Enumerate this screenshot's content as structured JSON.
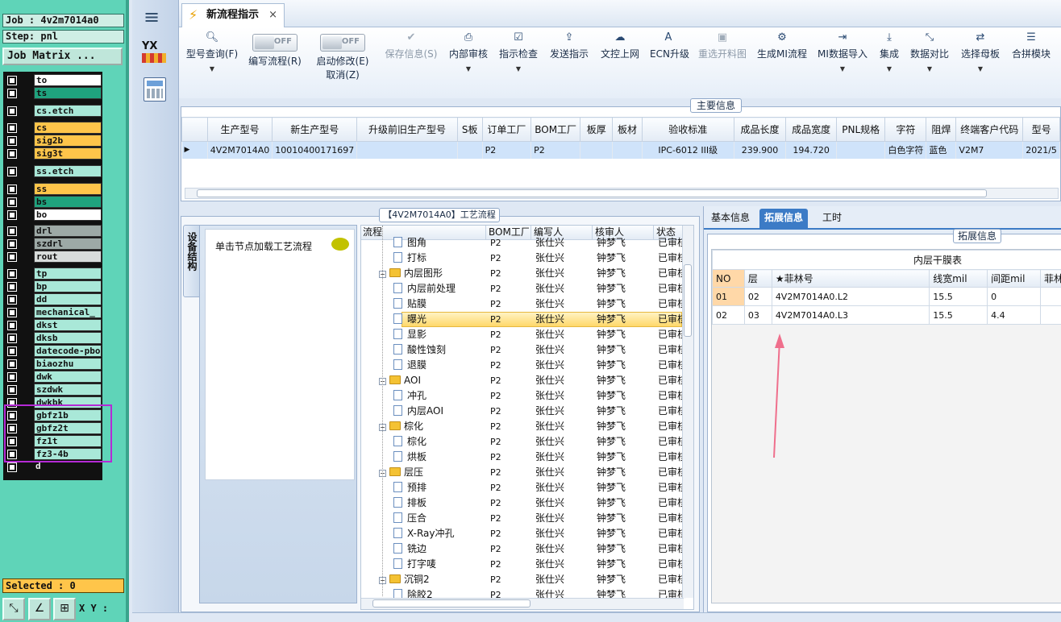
{
  "genesis": {
    "job": "Job : 4v2m7014a0",
    "step": "Step: pnl",
    "matrix_button": "Job Matrix ...",
    "selected": "Selected : 0",
    "xy_label": "X Y :",
    "layers": [
      {
        "name": "to",
        "color": "#ffffff"
      },
      {
        "name": "ts",
        "color": "#1fa37e"
      },
      {
        "name": "cs.etch",
        "color": "#a9e8d8"
      },
      {
        "name": "cs",
        "color": "#ffc54a"
      },
      {
        "name": "sig2b",
        "color": "#ffc54a"
      },
      {
        "name": "sig3t",
        "color": "#ffc54a"
      },
      {
        "name": "ss.etch",
        "color": "#a9e8d8"
      },
      {
        "name": "ss",
        "color": "#ffc54a"
      },
      {
        "name": "bs",
        "color": "#1fa37e"
      },
      {
        "name": "bo",
        "color": "#ffffff"
      },
      {
        "name": "drl",
        "color": "#9da9a6"
      },
      {
        "name": "szdrl",
        "color": "#9da9a6"
      },
      {
        "name": "rout",
        "color": "#d8dcdb"
      },
      {
        "name": "tp",
        "color": "#a9e8d8"
      },
      {
        "name": "bp",
        "color": "#a9e8d8"
      },
      {
        "name": "dd",
        "color": "#a9e8d8"
      },
      {
        "name": "mechanical_",
        "color": "#a9e8d8"
      },
      {
        "name": "dkst",
        "color": "#a9e8d8"
      },
      {
        "name": "dksb",
        "color": "#a9e8d8"
      },
      {
        "name": "datecode-pbo",
        "color": "#a9e8d8"
      },
      {
        "name": "biaozhu",
        "color": "#a9e8d8"
      },
      {
        "name": "dwk",
        "color": "#a9e8d8"
      },
      {
        "name": "szdwk",
        "color": "#a9e8d8"
      },
      {
        "name": "dwkbk",
        "color": "#a9e8d8"
      },
      {
        "name": "gbfz1b",
        "color": "#a9e8d8"
      },
      {
        "name": "gbfz2t",
        "color": "#a9e8d8"
      },
      {
        "name": "fz1t",
        "color": "#a9e8d8"
      },
      {
        "name": "fz3-4b",
        "color": "#a9e8d8"
      },
      {
        "name": "d",
        "color": "#111111"
      }
    ]
  },
  "nav": {
    "logo_text": "YX"
  },
  "tab": {
    "title": "新流程指示",
    "close": "×"
  },
  "toolbar": {
    "query": "型号查询(F)",
    "edit_flow": "编写流程(R)",
    "start_modify": "启动修改(E)",
    "cancel": "取消(Z)",
    "off": "OFF",
    "save": "保存信息(S)",
    "internal_review": "内部审核",
    "check": "指示检查",
    "send": "发送指示",
    "upload": "文控上网",
    "ecn": "ECN升级",
    "reopen": "重选开料图",
    "gen_mi": "生成MI流程",
    "mi_import": "MI数据导入",
    "integrate": "集成",
    "compare": "数据对比",
    "select_master": "选择母板",
    "panelize": "合拼模块"
  },
  "main_info": {
    "title": "主要信息",
    "headers": [
      "生产型号",
      "新生产型号",
      "升级前旧生产型号",
      "S板",
      "订单工厂",
      "BOM工厂",
      "板厚",
      "板材",
      "验收标准",
      "成品长度",
      "成品宽度",
      "PNL规格",
      "字符",
      "阻焊",
      "终端客户代码",
      "型号"
    ],
    "row": [
      "4V2M7014A0",
      "10010400171697",
      "",
      "",
      "P2",
      "P2",
      "",
      "",
      "IPC-6012 III级",
      "239.900",
      "194.720",
      "",
      "白色字符",
      "蓝色",
      "V2M7",
      "2021/5"
    ]
  },
  "process": {
    "title": "【4V2M7014A0】工艺流程",
    "side_tab": "设备结构",
    "hint": "单击节点加载工艺流程",
    "headers": [
      "流程",
      "BOM工厂",
      "编写人",
      "核审人",
      "状态"
    ],
    "rows": [
      {
        "level": 2,
        "type": "doc",
        "name": "图角",
        "bom": "P2",
        "writer": "张仕兴",
        "reviewer": "钟梦飞",
        "status": "已审核"
      },
      {
        "level": 2,
        "type": "doc",
        "name": "打标",
        "bom": "P2",
        "writer": "张仕兴",
        "reviewer": "钟梦飞",
        "status": "已审核"
      },
      {
        "level": 1,
        "type": "folder",
        "name": "内层图形",
        "bom": "P2",
        "writer": "张仕兴",
        "reviewer": "钟梦飞",
        "status": "已审核"
      },
      {
        "level": 2,
        "type": "doc",
        "name": "内层前处理",
        "bom": "P2",
        "writer": "张仕兴",
        "reviewer": "钟梦飞",
        "status": "已审核"
      },
      {
        "level": 2,
        "type": "doc",
        "name": "贴膜",
        "bom": "P2",
        "writer": "张仕兴",
        "reviewer": "钟梦飞",
        "status": "已审核"
      },
      {
        "level": 2,
        "type": "doc",
        "name": "曝光",
        "bom": "P2",
        "writer": "张仕兴",
        "reviewer": "钟梦飞",
        "status": "已审核",
        "selected": true
      },
      {
        "level": 2,
        "type": "doc",
        "name": "显影",
        "bom": "P2",
        "writer": "张仕兴",
        "reviewer": "钟梦飞",
        "status": "已审核"
      },
      {
        "level": 2,
        "type": "doc",
        "name": "酸性蚀刻",
        "bom": "P2",
        "writer": "张仕兴",
        "reviewer": "钟梦飞",
        "status": "已审核"
      },
      {
        "level": 2,
        "type": "doc",
        "name": "退膜",
        "bom": "P2",
        "writer": "张仕兴",
        "reviewer": "钟梦飞",
        "status": "已审核"
      },
      {
        "level": 1,
        "type": "folder",
        "name": "AOI",
        "bom": "P2",
        "writer": "张仕兴",
        "reviewer": "钟梦飞",
        "status": "已审核"
      },
      {
        "level": 2,
        "type": "doc",
        "name": "冲孔",
        "bom": "P2",
        "writer": "张仕兴",
        "reviewer": "钟梦飞",
        "status": "已审核"
      },
      {
        "level": 2,
        "type": "doc",
        "name": "内层AOI",
        "bom": "P2",
        "writer": "张仕兴",
        "reviewer": "钟梦飞",
        "status": "已审核"
      },
      {
        "level": 1,
        "type": "folder",
        "name": "棕化",
        "bom": "P2",
        "writer": "张仕兴",
        "reviewer": "钟梦飞",
        "status": "已审核"
      },
      {
        "level": 2,
        "type": "doc",
        "name": "棕化",
        "bom": "P2",
        "writer": "张仕兴",
        "reviewer": "钟梦飞",
        "status": "已审核"
      },
      {
        "level": 2,
        "type": "doc",
        "name": "烘板",
        "bom": "P2",
        "writer": "张仕兴",
        "reviewer": "钟梦飞",
        "status": "已审核"
      },
      {
        "level": 1,
        "type": "folder",
        "name": "层压",
        "bom": "P2",
        "writer": "张仕兴",
        "reviewer": "钟梦飞",
        "status": "已审核"
      },
      {
        "level": 2,
        "type": "doc",
        "name": "预排",
        "bom": "P2",
        "writer": "张仕兴",
        "reviewer": "钟梦飞",
        "status": "已审核"
      },
      {
        "level": 2,
        "type": "doc",
        "name": "排板",
        "bom": "P2",
        "writer": "张仕兴",
        "reviewer": "钟梦飞",
        "status": "已审核"
      },
      {
        "level": 2,
        "type": "doc",
        "name": "压合",
        "bom": "P2",
        "writer": "张仕兴",
        "reviewer": "钟梦飞",
        "status": "已审核"
      },
      {
        "level": 2,
        "type": "doc",
        "name": "X-Ray冲孔",
        "bom": "P2",
        "writer": "张仕兴",
        "reviewer": "钟梦飞",
        "status": "已审核"
      },
      {
        "level": 2,
        "type": "doc",
        "name": "铣边",
        "bom": "P2",
        "writer": "张仕兴",
        "reviewer": "钟梦飞",
        "status": "已审核"
      },
      {
        "level": 2,
        "type": "doc",
        "name": "打字唛",
        "bom": "P2",
        "writer": "张仕兴",
        "reviewer": "钟梦飞",
        "status": "已审核"
      },
      {
        "level": 1,
        "type": "folder",
        "name": "沉铜2",
        "bom": "P2",
        "writer": "张仕兴",
        "reviewer": "钟梦飞",
        "status": "已审核"
      },
      {
        "level": 2,
        "type": "doc",
        "name": "除胶2",
        "bom": "P2",
        "writer": "张仕兴",
        "reviewer": "钟梦飞",
        "status": "已审核"
      }
    ]
  },
  "right": {
    "tabs": [
      "基本信息",
      "拓展信息",
      "工时"
    ],
    "active_tab": "拓展信息",
    "section_title": "拓展信息",
    "table_title": "内层干膜表",
    "headers": [
      "NO",
      "层",
      "★菲林号",
      "线宽mil",
      "间距mil",
      "菲林"
    ],
    "rows": [
      [
        "01",
        "02",
        "4V2M7014A0.L2",
        "15.5",
        "0",
        ""
      ],
      [
        "02",
        "03",
        "4V2M7014A0.L3",
        "15.5",
        "4.4",
        ""
      ]
    ]
  }
}
